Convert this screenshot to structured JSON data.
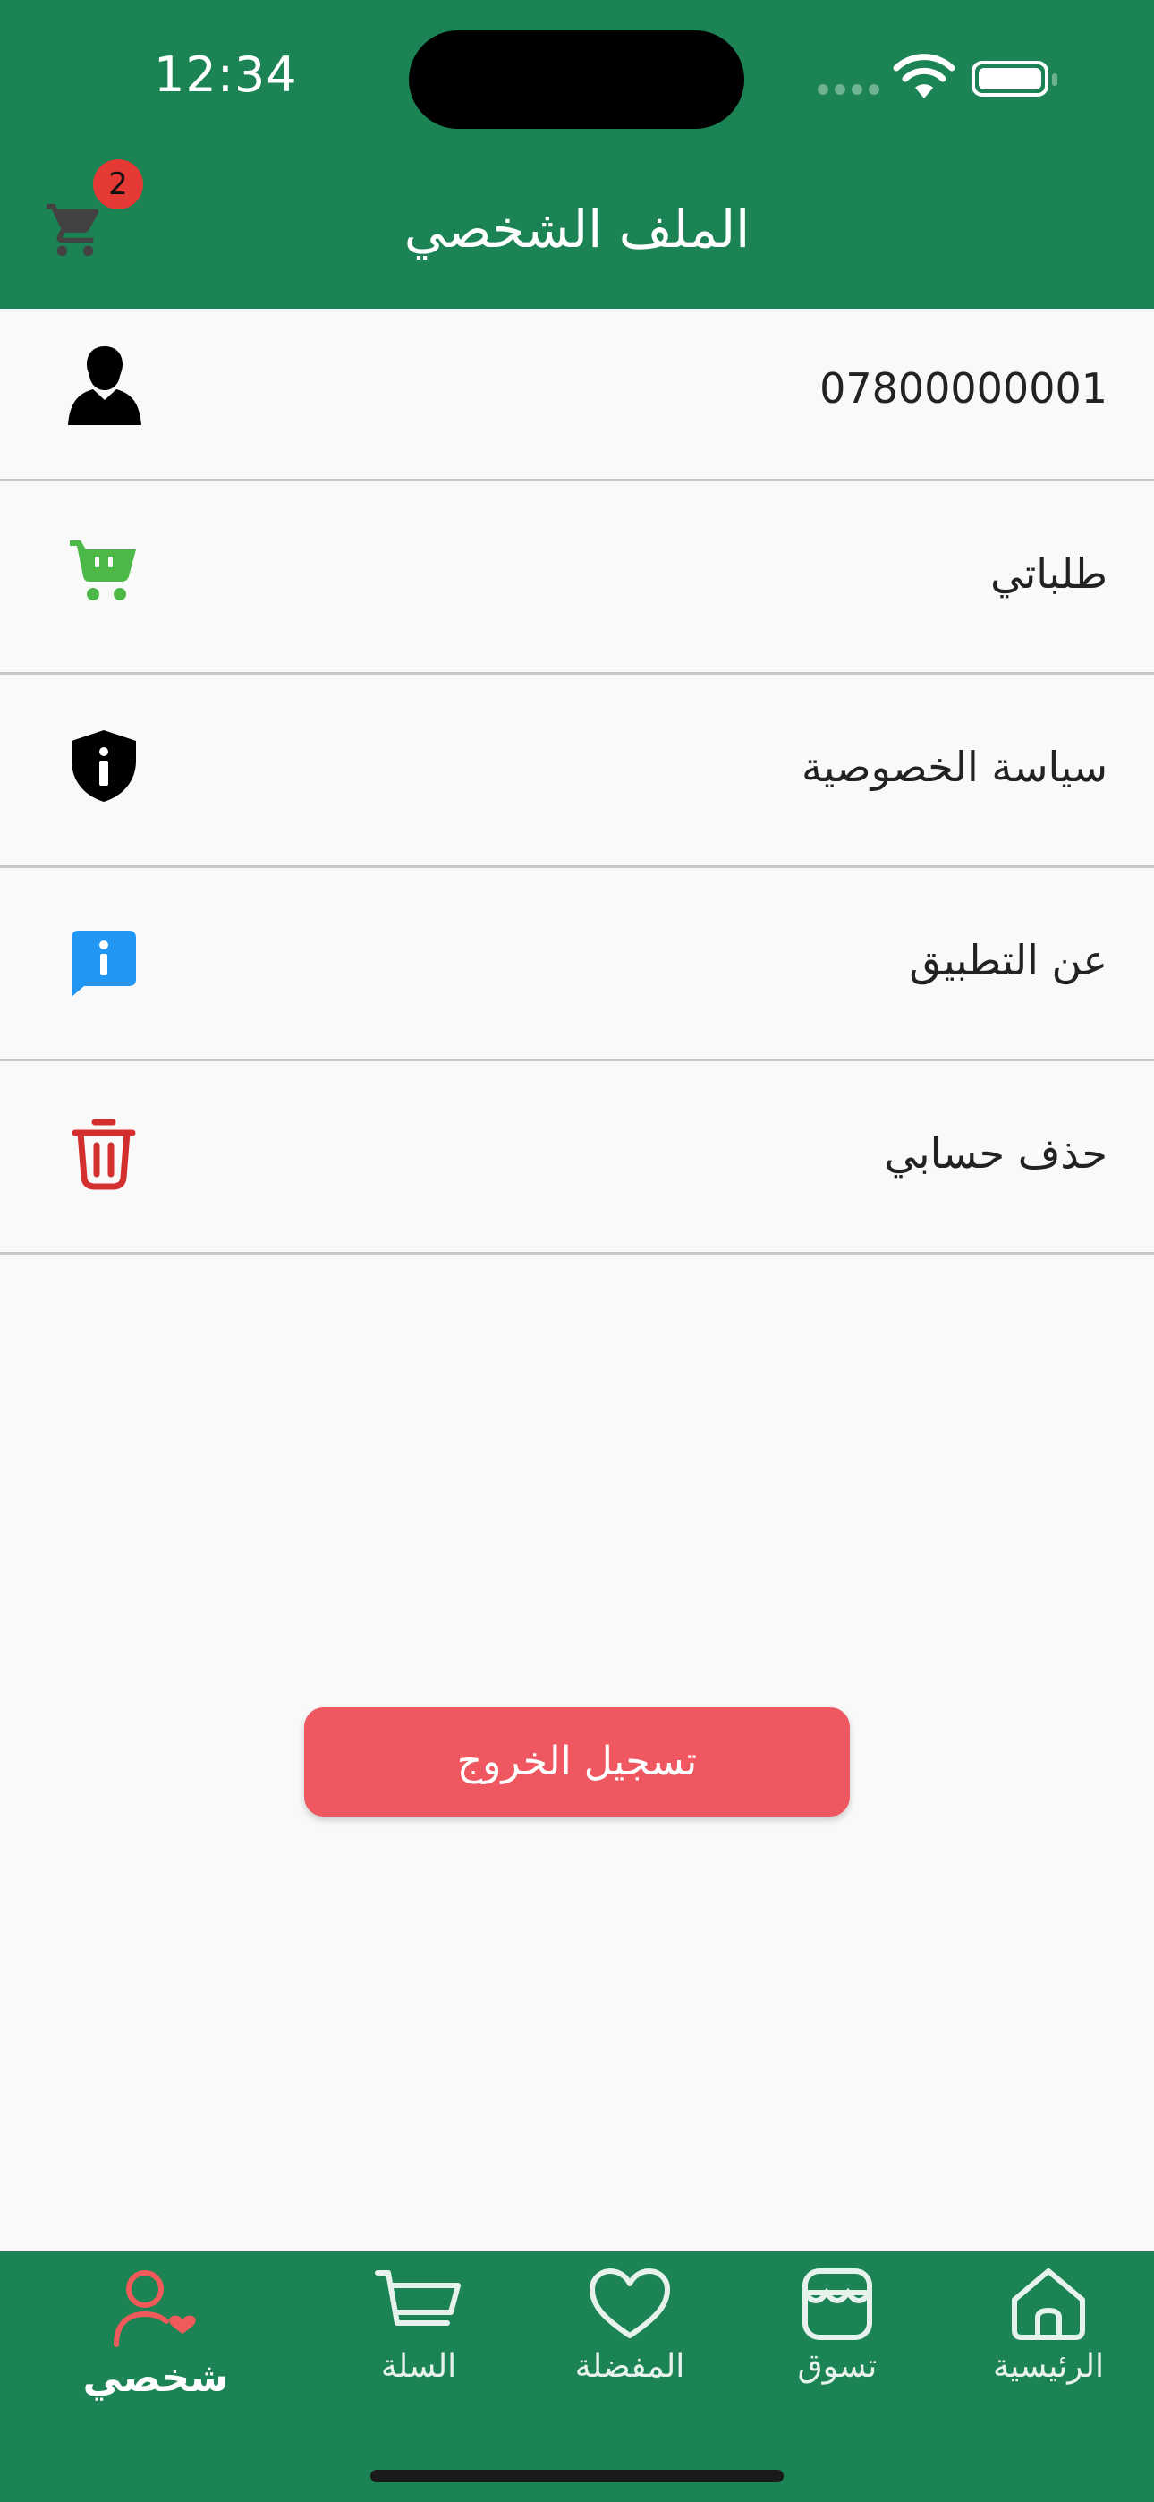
{
  "status_bar": {
    "time": "12:34"
  },
  "header": {
    "title": "الملف الشخصي",
    "cart_count": "2"
  },
  "menu": [
    {
      "label": "07800000001",
      "icon": "user-icon"
    },
    {
      "label": "طلباتي",
      "icon": "cart-icon"
    },
    {
      "label": "سياسة الخصوصية",
      "icon": "shield-info-icon"
    },
    {
      "label": "عن التطبيق",
      "icon": "info-chat-icon"
    },
    {
      "label": "حذف حسابي",
      "icon": "trash-icon"
    }
  ],
  "logout": {
    "label": "تسجيل الخروج"
  },
  "bottom_nav": [
    {
      "label": "شخصي",
      "icon": "profile-heart-icon",
      "active": true
    },
    {
      "label": "السلة",
      "icon": "basket-icon",
      "active": false
    },
    {
      "label": "المفضلة",
      "icon": "heart-icon",
      "active": false
    },
    {
      "label": "تسوق",
      "icon": "store-icon",
      "active": false
    },
    {
      "label": "الرئيسية",
      "icon": "home-icon",
      "active": false
    }
  ],
  "colors": {
    "primary": "#1b8354",
    "logout": "#ef5860",
    "badge": "#e53935",
    "orders_icon": "#4cb848",
    "about_icon": "#2196f3",
    "delete_icon": "#d32f2f",
    "active_nav": "#f05a5a"
  }
}
